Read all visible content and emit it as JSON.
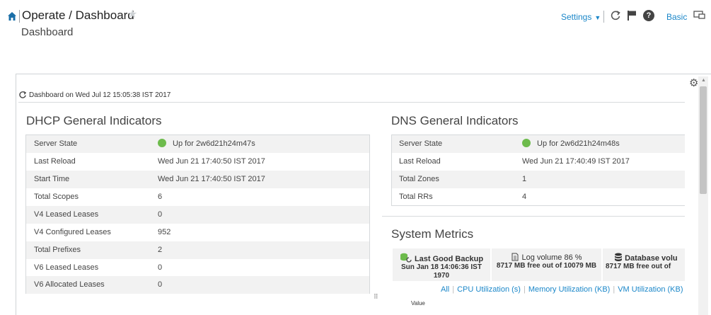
{
  "header": {
    "breadcrumb": "Operate / Dashboard",
    "subtitle": "Dashboard",
    "settings_label": "Settings",
    "basic_label": "Basic"
  },
  "dashboard": {
    "timestamp": "Dashboard on Wed Jul 12 15:05:38 IST 2017"
  },
  "dhcp": {
    "title": "DHCP General Indicators",
    "rows": [
      {
        "label": "Server State",
        "value": "Up for 2w6d21h24m47s"
      },
      {
        "label": "Last Reload",
        "value": "Wed Jun 21 17:40:50 IST 2017"
      },
      {
        "label": "Start Time",
        "value": "Wed Jun 21 17:40:50 IST 2017"
      },
      {
        "label": "Total Scopes",
        "value": "6"
      },
      {
        "label": "V4 Leased Leases",
        "value": "0"
      },
      {
        "label": "V4 Configured Leases",
        "value": "952"
      },
      {
        "label": "Total Prefixes",
        "value": "2"
      },
      {
        "label": "V6 Leased Leases",
        "value": "0"
      },
      {
        "label": "V6 Allocated Leases",
        "value": "0"
      }
    ]
  },
  "dns": {
    "title": "DNS General Indicators",
    "rows": [
      {
        "label": "Server State",
        "value": "Up for 2w6d21h24m48s"
      },
      {
        "label": "Last Reload",
        "value": "Wed Jun 21 17:40:49 IST 2017"
      },
      {
        "label": "Total Zones",
        "value": "1"
      },
      {
        "label": "Total RRs",
        "value": "4"
      }
    ]
  },
  "metrics": {
    "title": "System Metrics",
    "tiles": [
      {
        "head": "Last Good Backup",
        "line2": "Sun Jan 18 14:06:36 IST",
        "line3": "1970"
      },
      {
        "head": "Log volume 86 %",
        "line2": "8717 MB free out of 10079 MB"
      },
      {
        "head": "Database volu",
        "line2": "8717 MB free out of"
      }
    ],
    "links": {
      "all": "All",
      "cpu": "CPU Utilization (s)",
      "memory": "Memory Utilization (KB)",
      "vm": "VM Utilization (KB)"
    },
    "chart_value_label": "Value"
  },
  "colors": {
    "accent": "#1b87c9",
    "status_up": "#6dbb4c"
  },
  "icons": [
    "home-icon",
    "star-icon",
    "refresh-icon",
    "flag-icon",
    "help-icon",
    "monitor-icon",
    "gear-icon",
    "backup-icon",
    "log-icon",
    "database-icon",
    "resize-icon"
  ]
}
